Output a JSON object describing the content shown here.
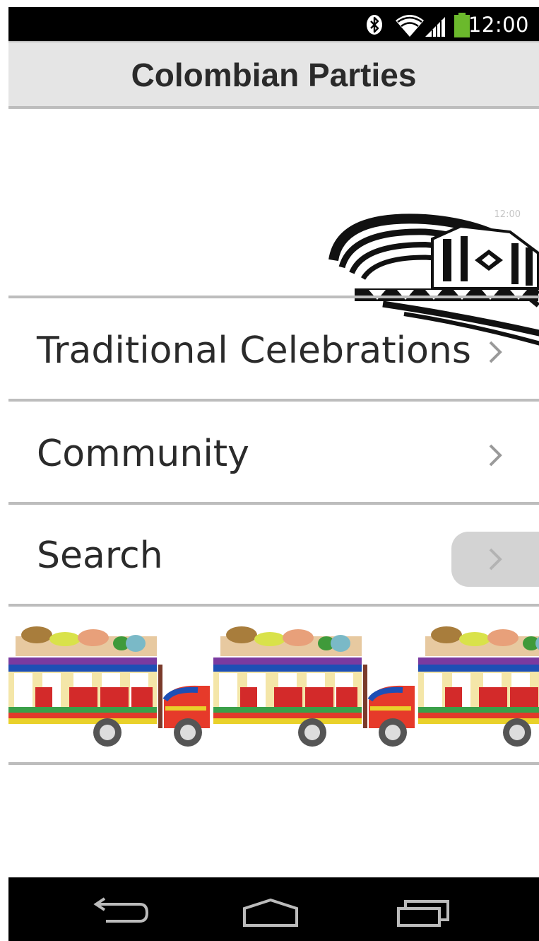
{
  "status_bar": {
    "time": "12:00",
    "icons": [
      "bluetooth-icon",
      "wifi-icon",
      "signal-icon",
      "battery-icon"
    ],
    "battery_color": "#6bb92c"
  },
  "action_bar": {
    "title": "Colombian Parties"
  },
  "banner_hat": {
    "image": "sombrero-vueltiao-image",
    "overlay_time": "12:00"
  },
  "menu": {
    "items": [
      {
        "label": "Traditional Celebrations",
        "icon": "chevron-right-icon"
      },
      {
        "label": "Community",
        "icon": "chevron-right-icon"
      },
      {
        "label": "Search",
        "icon": "chevron-right-icon",
        "pressed": true
      }
    ]
  },
  "banner_bus": {
    "image": "chiva-bus-image"
  },
  "nav_bar": {
    "buttons": [
      "back-icon",
      "home-icon",
      "recent-apps-icon"
    ]
  },
  "colors": {
    "divider": "#bdbdbd",
    "action_bar_bg": "#e5e5e5",
    "text": "#2b2b2b",
    "pressed": "#d3d3d3"
  }
}
